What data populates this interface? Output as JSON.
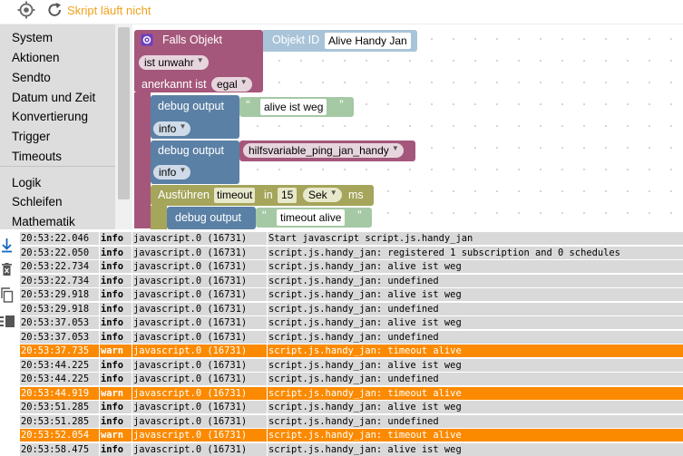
{
  "toolbar": {
    "status": "Skript läuft nicht"
  },
  "categories": [
    "System",
    "Aktionen",
    "Sendto",
    "Datum und Zeit",
    "Konvertierung",
    "Trigger",
    "Timeouts",
    "Logik",
    "Schleifen",
    "Mathematik"
  ],
  "blocks": {
    "falls_objekt": "Falls Objekt",
    "objekt_id": "Objekt ID",
    "objekt_value": "Alive Handy Jan",
    "ist_unwahr": "ist unwahr",
    "anerkannt_ist": "anerkannt ist",
    "egal": "egal",
    "debug1_label": "debug output",
    "debug1_text": "alive ist weg",
    "debug1_level": "info",
    "debug2_label": "debug output",
    "debug2_var": "hilfsvariable_ping_jan_handy",
    "debug2_level": "info",
    "ausfuehren": "Ausführen",
    "timeout": "timeout",
    "in": "in",
    "timeout_value": "15",
    "unit_sek": "Sek",
    "ms": "ms",
    "debug3_label": "debug output",
    "debug3_text": "timeout alive",
    "quote": "“ ”"
  },
  "colors": {
    "event_purple": "#a5577b",
    "control_blue": "#5b80a5",
    "timeout_olive": "#a5a55b",
    "warn_orange": "#fb8a00",
    "status_orange": "#f0a21e"
  },
  "log": [
    {
      "time": "20:53:22.046",
      "level": "info",
      "src": "javascript.0 (16731)",
      "msg": "Start javascript script.js.handy_jan"
    },
    {
      "time": "20:53:22.050",
      "level": "info",
      "src": "javascript.0 (16731)",
      "msg": "script.js.handy_jan: registered 1 subscription and 0 schedules"
    },
    {
      "time": "20:53:22.734",
      "level": "info",
      "src": "javascript.0 (16731)",
      "msg": "script.js.handy_jan: alive ist weg"
    },
    {
      "time": "20:53:22.734",
      "level": "info",
      "src": "javascript.0 (16731)",
      "msg": "script.js.handy_jan: undefined"
    },
    {
      "time": "20:53:29.918",
      "level": "info",
      "src": "javascript.0 (16731)",
      "msg": "script.js.handy_jan: alive ist weg"
    },
    {
      "time": "20:53:29.918",
      "level": "info",
      "src": "javascript.0 (16731)",
      "msg": "script.js.handy_jan: undefined"
    },
    {
      "time": "20:53:37.053",
      "level": "info",
      "src": "javascript.0 (16731)",
      "msg": "script.js.handy_jan: alive ist weg"
    },
    {
      "time": "20:53:37.053",
      "level": "info",
      "src": "javascript.0 (16731)",
      "msg": "script.js.handy_jan: undefined"
    },
    {
      "time": "20:53:37.735",
      "level": "warn",
      "src": "javascript.0 (16731)",
      "msg": "script.js.handy_jan: timeout alive"
    },
    {
      "time": "20:53:44.225",
      "level": "info",
      "src": "javascript.0 (16731)",
      "msg": "script.js.handy_jan: alive ist weg"
    },
    {
      "time": "20:53:44.225",
      "level": "info",
      "src": "javascript.0 (16731)",
      "msg": "script.js.handy_jan: undefined"
    },
    {
      "time": "20:53:44.919",
      "level": "warn",
      "src": "javascript.0 (16731)",
      "msg": "script.js.handy_jan: timeout alive"
    },
    {
      "time": "20:53:51.285",
      "level": "info",
      "src": "javascript.0 (16731)",
      "msg": "script.js.handy_jan: alive ist weg"
    },
    {
      "time": "20:53:51.285",
      "level": "info",
      "src": "javascript.0 (16731)",
      "msg": "script.js.handy_jan: undefined"
    },
    {
      "time": "20:53:52.054",
      "level": "warn",
      "src": "javascript.0 (16731)",
      "msg": "script.js.handy_jan: timeout alive"
    },
    {
      "time": "20:53:58.475",
      "level": "info",
      "src": "javascript.0 (16731)",
      "msg": "script.js.handy_jan: alive ist weg"
    }
  ]
}
